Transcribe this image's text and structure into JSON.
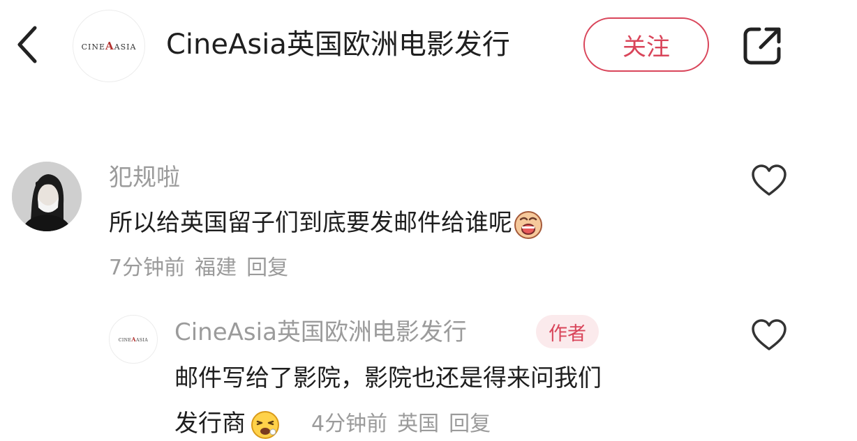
{
  "header": {
    "account_name": "CineAsia英国欧洲电影发行",
    "follow_label": "关注",
    "logo_text_left": "CINE",
    "logo_text_mark": "A",
    "logo_text_right": "ASIA",
    "icons": [
      "back-arrow-icon",
      "share-icon"
    ]
  },
  "comments": [
    {
      "user": "犯规啦",
      "text": "所以给英国留子们到底要发邮件给谁呢",
      "emoji": "crying-face-icon",
      "time": "7分钟前",
      "location": "福建",
      "reply_label": "回复"
    },
    {
      "user": "CineAsia英国欧洲电影发行",
      "badge": "作者",
      "text_line1": "邮件写给了影院，影院也还是得来问我们",
      "text_line2": "发行商",
      "emoji": "tired-face-icon",
      "time": "4分钟前",
      "location": "英国",
      "reply_label": "回复"
    }
  ],
  "colors": {
    "accent": "#d9455a",
    "muted_text": "#9b9b9b",
    "badge_bg": "#fbeaec"
  }
}
